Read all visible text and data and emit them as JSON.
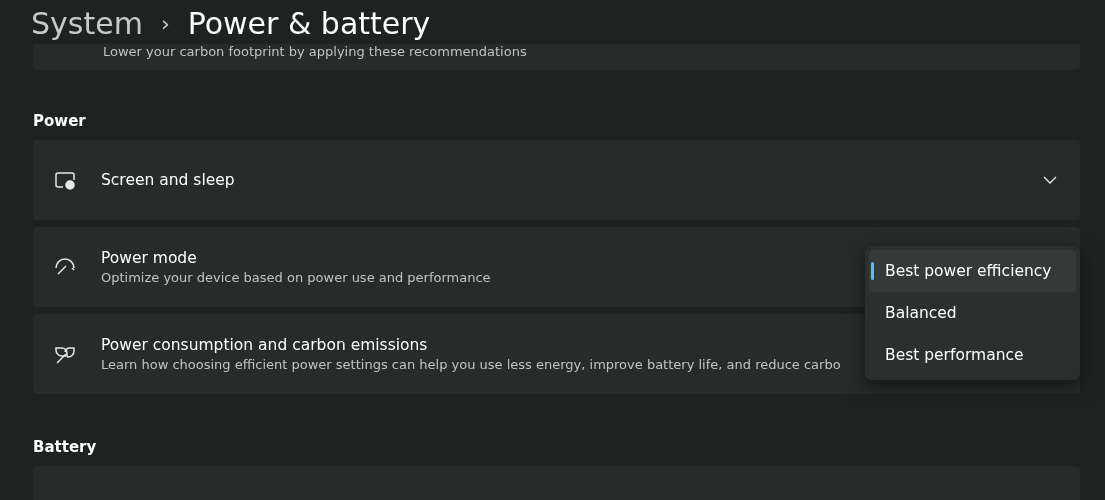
{
  "breadcrumb": {
    "parent": "System",
    "separator": "›",
    "current": "Power & battery"
  },
  "top_card": {
    "description": "Lower your carbon footprint by applying these recommendations"
  },
  "sections": [
    {
      "title": "Power",
      "items": [
        {
          "kind": "expander",
          "title": "Screen and sleep",
          "expanded": false
        },
        {
          "kind": "dropdown",
          "title": "Power mode",
          "description": "Optimize your device based on power use and performance",
          "menu": [
            {
              "label": "Best power efficiency",
              "selected": true
            },
            {
              "label": "Balanced",
              "selected": false
            },
            {
              "label": "Best performance",
              "selected": false
            }
          ]
        },
        {
          "kind": "link",
          "title": "Power consumption and carbon emissions",
          "description": "Learn how choosing efficient power settings can help you use less energy, improve battery life, and reduce carbo"
        }
      ]
    },
    {
      "title": "Battery"
    }
  ]
}
